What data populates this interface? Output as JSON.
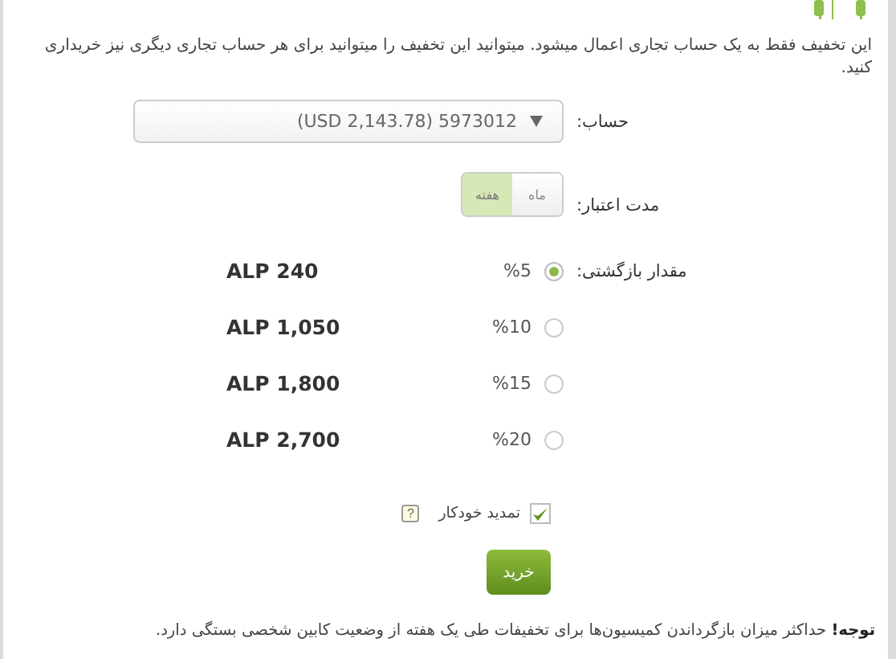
{
  "description": "این تخفیف فقط به یک حساب تجاری اعمال میشود. میتوانید این تخفیف را میتوانید برای هر حساب تجاری دیگری نیز خریداری کنید.",
  "account": {
    "label": "حساب:",
    "value": "(USD 2,143.78) 5973012"
  },
  "validity": {
    "label": "مدت اعتبار:",
    "options": [
      {
        "label": "ماه",
        "selected": false
      },
      {
        "label": "هفته",
        "selected": true
      }
    ]
  },
  "cashback": {
    "label": "مقدار بازگشتی:",
    "options": [
      {
        "percent": "%5",
        "amount": "ALP 240",
        "selected": true
      },
      {
        "percent": "%10",
        "amount": "ALP 1,050",
        "selected": false
      },
      {
        "percent": "%15",
        "amount": "ALP 1,800",
        "selected": false
      },
      {
        "percent": "%20",
        "amount": "ALP 2,700",
        "selected": false
      }
    ]
  },
  "auto_renew": {
    "label": "تمدید خودکار",
    "checked": true,
    "help": "?"
  },
  "buy_button": "خرید",
  "note": "**توجه!** حداکثر میزان بازگرداندن کمیسیون‌ها برای تخفیفات طی یک هفته از وضعیت کابین شخصی بستگی دارد."
}
